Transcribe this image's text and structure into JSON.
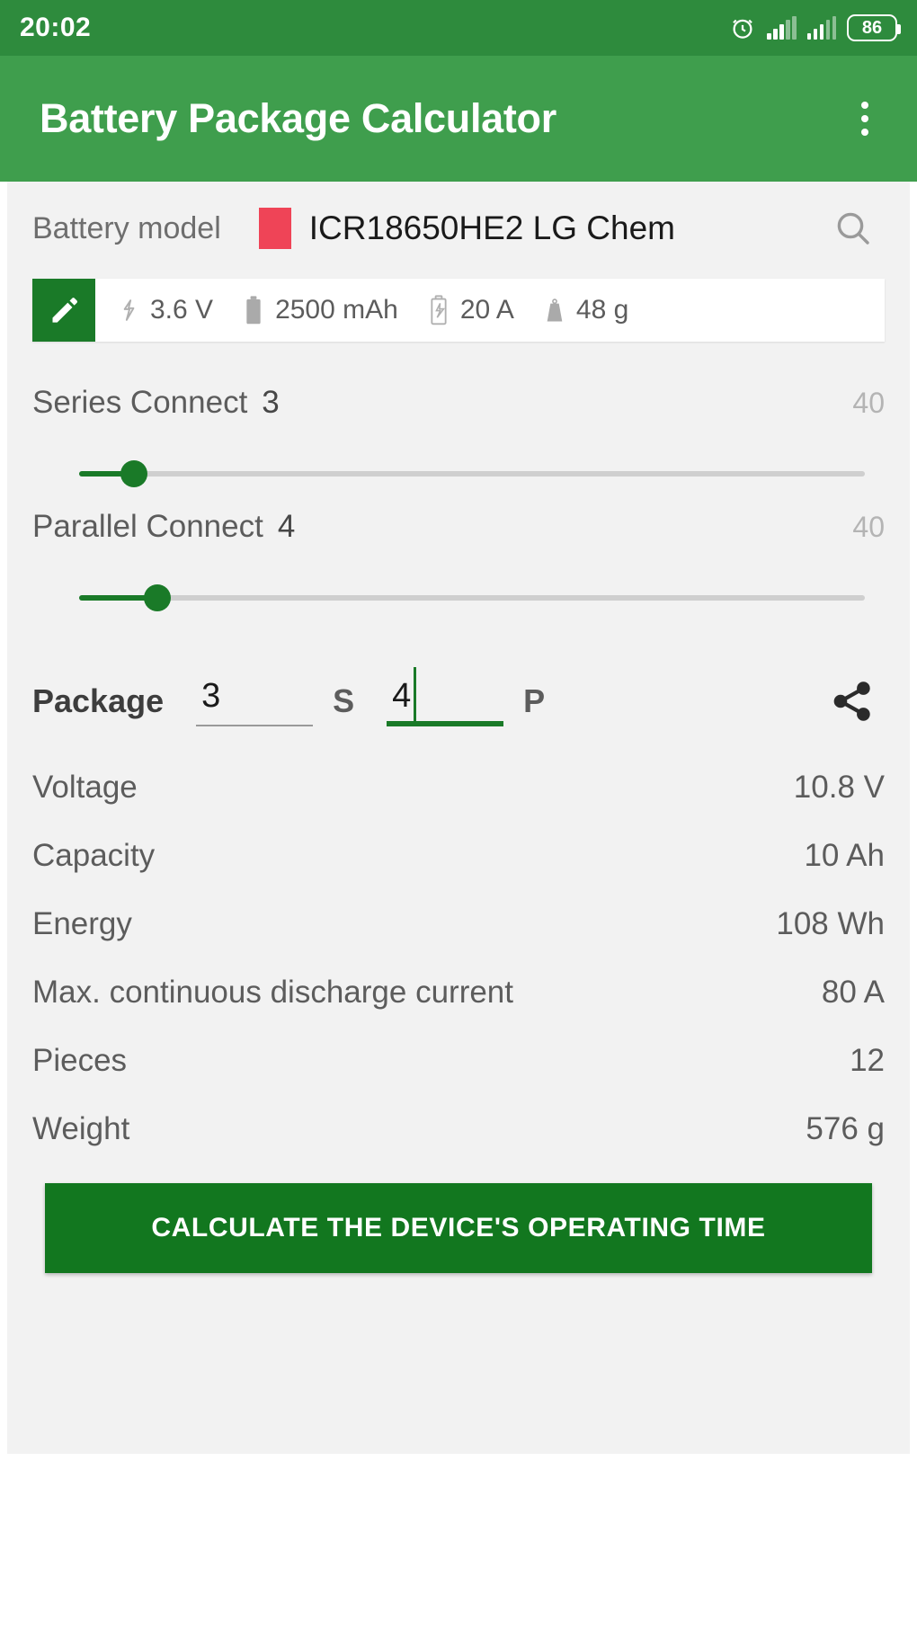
{
  "status_bar": {
    "clock": "20:02",
    "battery_percent": "86",
    "alarm_icon": "alarm-clock-icon",
    "signal_icon": "signal-bars-icon"
  },
  "app_bar": {
    "title": "Battery Package Calculator",
    "overflow_icon": "more-vertical-icon"
  },
  "battery_model": {
    "label": "Battery model",
    "name": "ICR18650HE2 LG Chem",
    "swatch_color": "#ef4457",
    "search_icon": "search-icon"
  },
  "specs": {
    "edit_icon": "pencil-edit-icon",
    "items": [
      {
        "icon": "bolt-icon",
        "value": "3.6 V"
      },
      {
        "icon": "battery-full-icon",
        "value": "2500 mAh"
      },
      {
        "icon": "battery-bolt-icon",
        "value": "20 A"
      },
      {
        "icon": "weight-icon",
        "value": "48 g"
      }
    ]
  },
  "sliders": [
    {
      "label": "Series Connect",
      "value": "3",
      "max": "40",
      "percent": 7
    },
    {
      "label": "Parallel Connect",
      "value": "4",
      "max": "40",
      "percent": 10
    }
  ],
  "package": {
    "label": "Package",
    "series_value": "3",
    "series_suffix": "S",
    "parallel_value": "4",
    "parallel_suffix": "P",
    "share_icon": "share-icon",
    "focused_field": "parallel"
  },
  "results": [
    {
      "label": "Voltage",
      "value": "10.8 V"
    },
    {
      "label": "Capacity",
      "value": "10 Ah"
    },
    {
      "label": "Energy",
      "value": "108 Wh"
    },
    {
      "label": "Max. continuous discharge current",
      "value": "80 A"
    },
    {
      "label": "Pieces",
      "value": "12"
    },
    {
      "label": "Weight",
      "value": "576 g"
    }
  ],
  "cta": {
    "label": "CALCULATE THE DEVICE'S OPERATING TIME"
  },
  "colors": {
    "status_bar": "#2e8b3d",
    "app_bar": "#3f9e4d",
    "accent": "#1a7a28",
    "cta": "#12771f",
    "page_bg": "#f2f2f2"
  }
}
